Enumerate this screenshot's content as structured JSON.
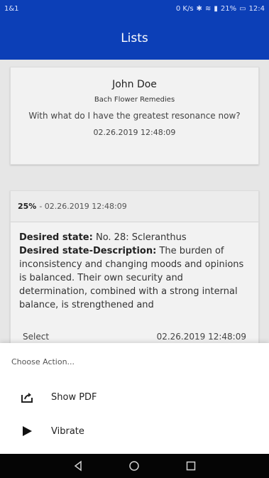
{
  "status_bar": {
    "left": "1&1",
    "network_speed": "0 K/s",
    "signal_battery": "21%",
    "time": "12:4"
  },
  "app_bar": {
    "title": "Lists"
  },
  "summary": {
    "name": "John Doe",
    "subtitle": "Bach Flower Remedies",
    "question": "With what do I have the greatest resonance now?",
    "timestamp": "02.26.2019 12:48:09"
  },
  "result": {
    "percent": "25%",
    "header_rest": "- 02.26.2019 12:48:09",
    "desired_state_label": "Desired state:",
    "desired_state_value": "No. 28: Scleranthus",
    "description_label": "Desired state-Description:",
    "description_text": "The burden of inconsistency and changing moods and opinions is balanced. Their own security and determination, combined with a strong internal balance, is strengthened and"
  },
  "faded_row": {
    "left": "Select",
    "right": "02.26.2019 12:48:09"
  },
  "bottom_sheet": {
    "title": "Choose Action...",
    "actions": [
      {
        "label": "Show PDF",
        "icon": "share-icon"
      },
      {
        "label": "Vibrate",
        "icon": "play-icon"
      }
    ]
  },
  "colors": {
    "primary": "#0c3fb7",
    "background": "#e6e6e6",
    "card": "#f2f2f2",
    "nav_bar": "#050505"
  }
}
